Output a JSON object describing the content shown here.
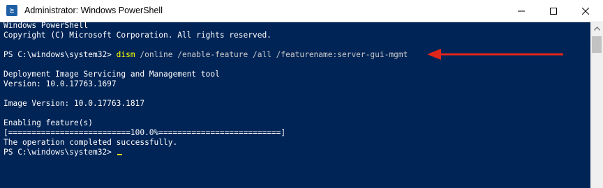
{
  "window": {
    "title": "Administrator: Windows PowerShell",
    "app_icon_glyph": "≥",
    "controls": {
      "minimize_icon": "minimize-icon",
      "maximize_icon": "maximize-icon",
      "close_icon": "close-icon"
    }
  },
  "console": {
    "lines": {
      "l0": "Windows PowerShell",
      "l1": "Copyright (C) Microsoft Corporation. All rights reserved.",
      "l3_prompt": "PS C:\\windows\\system32> ",
      "l3_cmd": "dism",
      "l3_args": " /online /enable-feature /all /featurename:server-gui-mgmt",
      "l5": "Deployment Image Servicing and Management tool",
      "l6": "Version: 10.0.17763.1697",
      "l8": "Image Version: 10.0.17763.1817",
      "l10": "Enabling feature(s)",
      "l11": "[==========================100.0%==========================]",
      "l12": "The operation completed successfully.",
      "l13_prompt": "PS C:\\windows\\system32> "
    }
  },
  "colors": {
    "console_bg": "#012456",
    "text": "#ffffff",
    "command": "#ffff00",
    "annotation_arrow": "#e0261b"
  }
}
